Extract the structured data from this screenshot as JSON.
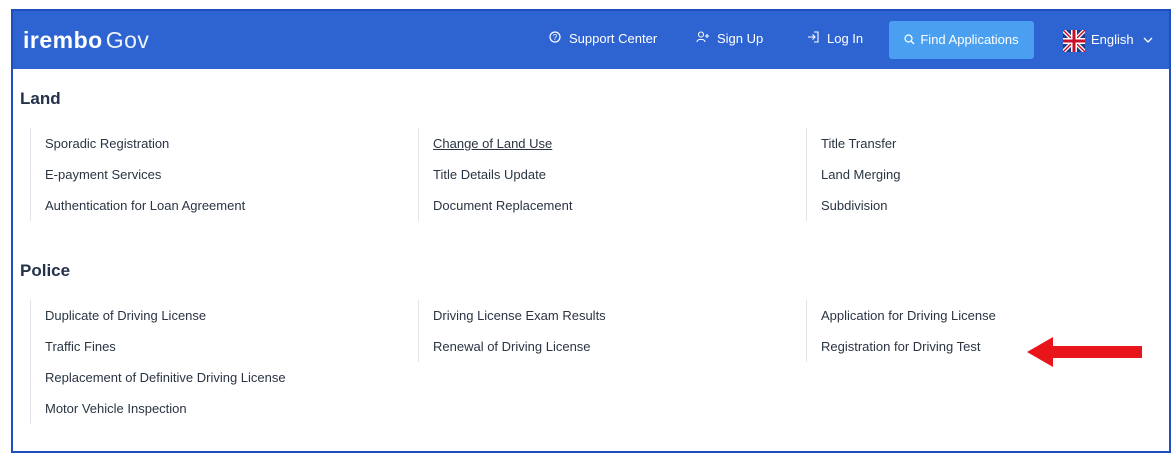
{
  "header": {
    "brand_main": "irembo",
    "brand_sub": "Gov",
    "support_label": "Support Center",
    "signup_label": "Sign Up",
    "login_label": "Log In",
    "find_label": "Find Applications",
    "language_label": "English"
  },
  "sections": {
    "land": {
      "title": "Land",
      "col1": [
        "Sporadic Registration",
        "E-payment Services",
        "Authentication for Loan Agreement"
      ],
      "col2": [
        "Change of Land Use",
        "Title Details Update",
        "Document Replacement"
      ],
      "col3": [
        "Title Transfer",
        "Land Merging",
        "Subdivision"
      ]
    },
    "police": {
      "title": "Police",
      "col1": [
        "Duplicate of Driving License",
        "Traffic Fines",
        "Replacement of Definitive Driving License",
        "Motor Vehicle Inspection"
      ],
      "col2": [
        "Driving License Exam Results",
        "Renewal of Driving License"
      ],
      "col3": [
        "Application for Driving License",
        "Registration for Driving Test"
      ]
    }
  },
  "colors": {
    "navbar": "#2e63d2",
    "find_button": "#4a9ff0",
    "annotation_arrow": "#e8161a"
  }
}
